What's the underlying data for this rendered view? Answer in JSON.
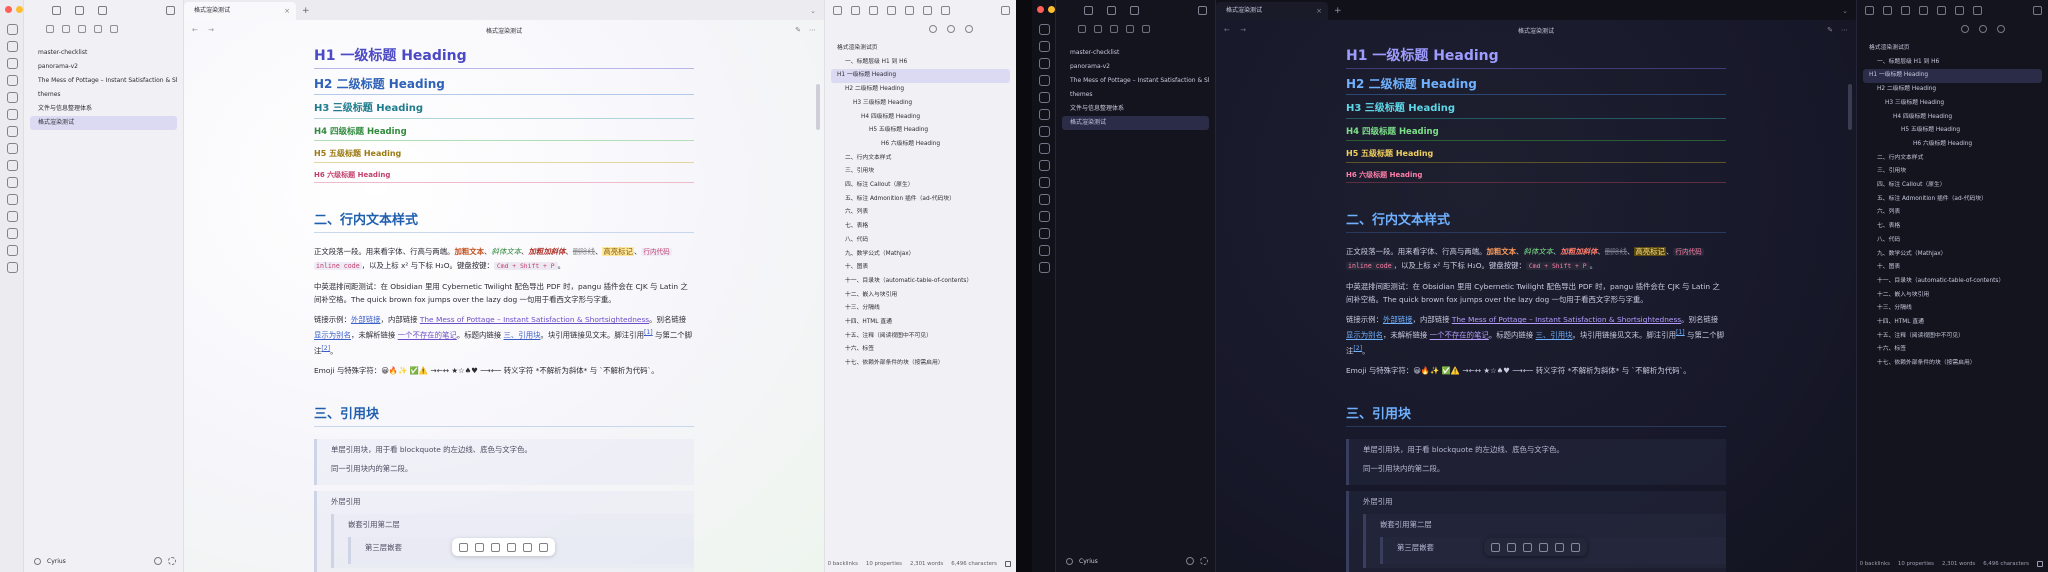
{
  "app": {
    "tab_title": "格式渲染测试",
    "note_title": "格式渲染测试",
    "tab_close": "×",
    "tab_add": "+",
    "tab_menu": "⌄",
    "nav_arrows": "← →",
    "view_actions": [
      "✎",
      "⋯"
    ],
    "colors": {
      "traffic_red": "#ff5f57",
      "traffic_yellow": "#febc2e",
      "traffic_green": "#28c840"
    }
  },
  "sidebar": {
    "files": [
      "master-checklist",
      "panorama-v2",
      "The Mess of Pottage – Instant Satisfaction & Shortsig...",
      "themes",
      "文件与信息整理体系",
      "格式渲染测试"
    ],
    "active_index": 5,
    "vault_name": "Cyrius"
  },
  "content": {
    "headings": [
      "H1 一级标题 Heading",
      "H2 二级标题 Heading",
      "H3 三级标题 Heading",
      "H4 四级标题 Heading",
      "H5 五级标题 Heading",
      "H6 六级标题 Heading"
    ],
    "section2": "二、行内文本样式",
    "p1": {
      "a": "正文段落一段。用来看字体、行高与两端。",
      "bold": "加粗文本",
      "sep1": "、",
      "italic": "斜体文本",
      "sep2": "、",
      "bolditalic": "加粗加斜体",
      "sep3": "、",
      "strike": "删除线",
      "sep4": "、",
      "mark": "高亮标记",
      "sep5": "、",
      "code_pre": "行内代码",
      "code": "inline code",
      "b": "，以及上标 x² 与下标 H₂O。键盘按键：",
      "kbd": "Cmd + Shift + P",
      "end": "。"
    },
    "p2": "中英混排间距测试：在 Obsidian 里用 Cybernetic Twilight 配色导出 PDF 时，pangu 插件会在 CJK 与 Latin 之间补空格。The quick brown fox jumps over the lazy dog 一句用于看西文字形与字重。",
    "p3": {
      "a": "链接示例：",
      "ext": "外部链接",
      "b": "，内部链接 ",
      "internal": "The Mess of Pottage – Instant Satisfaction & Shortsightedness",
      "c": "。别名链接 ",
      "alias": "显示为别名",
      "d": "，未解析链接 ",
      "unresolved": "一个不存在的笔记",
      "e": "。标题内链接 ",
      "heading_link": "三、引用块",
      "f": "。块引用链接见文末。脚注引用",
      "fn1": "[1]",
      "g": " 与第二个脚注",
      "fn2": "[2]",
      "end": "。"
    },
    "p4": "Emoji 与特殊字符：😀🔥✨ ✅⚠️ →←↔ ★☆♠♥ ⟶⟵ 转义字符 *不解析为斜体* 与 `不解析为代码`。",
    "section3": "三、引用块",
    "quote1": [
      "单层引用块，用于看 blockquote 的左边线、底色与文字色。",
      "同一引用块内的第二段。"
    ],
    "quote_outer": "外层引用",
    "quote_inner": "嵌套引用第二层",
    "quote_inner2": "第三层嵌套"
  },
  "outline": {
    "items": [
      {
        "text": "格式渲染测试页",
        "level": 1
      },
      {
        "text": "一、标题层级 H1 到 H6",
        "level": 2
      },
      {
        "text": "H1 一级标题 Heading",
        "level": 1
      },
      {
        "text": "H2 二级标题 Heading",
        "level": 2
      },
      {
        "text": "H3 三级标题 Heading",
        "level": 3
      },
      {
        "text": "H4 四级标题 Heading",
        "level": 4
      },
      {
        "text": "H5 五级标题 Heading",
        "level": 5
      },
      {
        "text": "H6 六级标题 Heading",
        "level": 6
      },
      {
        "text": "二、行内文本样式",
        "level": 2
      },
      {
        "text": "三、引用块",
        "level": 2
      },
      {
        "text": "四、标注 Callout（原生）",
        "level": 2
      },
      {
        "text": "五、标注 Admonition 插件（ad-代码块）",
        "level": 2
      },
      {
        "text": "六、列表",
        "level": 2
      },
      {
        "text": "七、表格",
        "level": 2
      },
      {
        "text": "八、代码",
        "level": 2
      },
      {
        "text": "九、数学公式（Mathjax）",
        "level": 2
      },
      {
        "text": "十、图表",
        "level": 2
      },
      {
        "text": "十一、目录块（automatic-table-of-contents）",
        "level": 2
      },
      {
        "text": "十二、嵌入与块引用",
        "level": 2
      },
      {
        "text": "十三、分隔线",
        "level": 2
      },
      {
        "text": "十四、HTML 直通",
        "level": 2
      },
      {
        "text": "十五、注释（阅读视图中不可见）",
        "level": 2
      },
      {
        "text": "十六、标签",
        "level": 2
      },
      {
        "text": "十七、依赖外部条件的块（按需启用）",
        "level": 2
      }
    ],
    "active_index": 2
  },
  "status": {
    "backlinks": "0 backlinks",
    "properties": "10 properties",
    "words": "2,301 words",
    "chars": "6,496 characters"
  }
}
